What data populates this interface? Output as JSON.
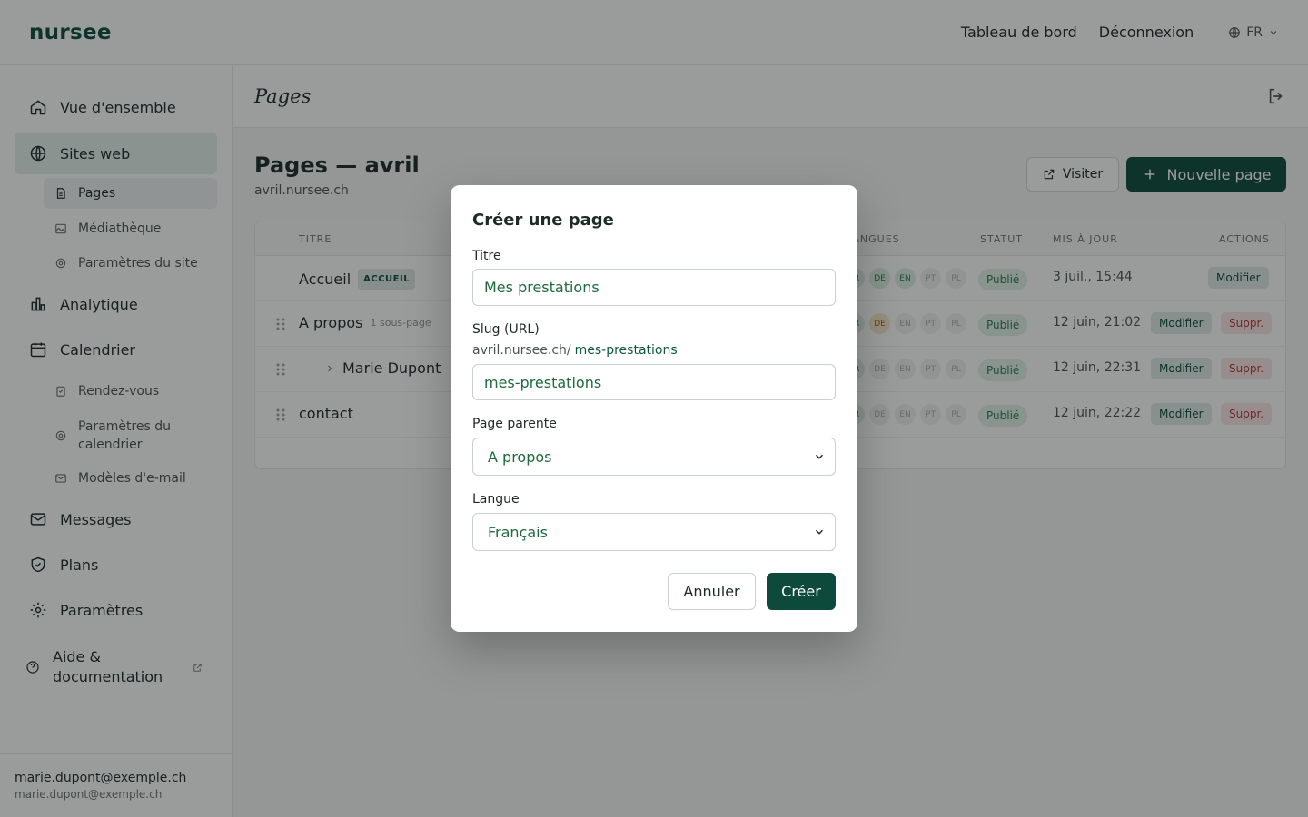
{
  "brand": "nursee",
  "topnav": {
    "dashboard": "Tableau de bord",
    "logout": "Déconnexion",
    "language": "FR"
  },
  "sidebar": {
    "items": [
      {
        "label": "Vue d'ensemble"
      },
      {
        "label": "Sites web"
      },
      {
        "label": "Analytique"
      },
      {
        "label": "Calendrier"
      },
      {
        "label": "Messages"
      },
      {
        "label": "Plans"
      },
      {
        "label": "Paramètres"
      },
      {
        "label": "Aide & documentation"
      }
    ],
    "site_sub": [
      "Pages",
      "Médiathèque",
      "Paramètres du site"
    ],
    "calendar_sub": [
      "Rendez-vous",
      "Paramètres du calendrier",
      "Modèles d'e-mail"
    ],
    "user_name": "marie.dupont@exemple.ch",
    "user_email": "marie.dupont@exemple.ch"
  },
  "main": {
    "header_title": "Pages",
    "page_title": "Pages — avril",
    "page_domain": "avril.nursee.ch",
    "visit_label": "Visiter",
    "new_page_label": "Nouvelle page"
  },
  "table": {
    "headers": {
      "title": "TITRE",
      "languages": "LANGUES",
      "status": "STATUT",
      "updated": "MIS À JOUR",
      "actions": "ACTIONS"
    },
    "rows": [
      {
        "title": "Accueil",
        "badge": "ACCUEIL",
        "status": "Publié",
        "updated": "3 juil., 15:44",
        "edit": "Modifier"
      },
      {
        "title": "A propos",
        "sub": "1 sous-page",
        "status": "Publié",
        "updated": "12 juin, 21:02",
        "edit": "Modifier",
        "delete": "Suppr."
      },
      {
        "title": "Marie Dupont",
        "status": "Publié",
        "updated": "12 juin, 22:31",
        "edit": "Modifier",
        "delete": "Suppr."
      },
      {
        "title": "contact",
        "status": "Publié",
        "updated": "12 juin, 22:22",
        "edit": "Modifier",
        "delete": "Suppr."
      }
    ],
    "lang_codes": [
      "FR",
      "DE",
      "EN",
      "PT",
      "PL"
    ]
  },
  "modal": {
    "title": "Créer une page",
    "title_label": "Titre",
    "title_value": "Mes prestations",
    "slug_label": "Slug (URL)",
    "slug_prefix": "avril.nursee.ch/",
    "slug_preview": "mes-prestations",
    "slug_value": "mes-prestations",
    "parent_label": "Page parente",
    "parent_value": "A propos",
    "lang_label": "Langue",
    "lang_value": "Français",
    "cancel": "Annuler",
    "create": "Créer"
  },
  "colors": {
    "brand": "#0d4a3c",
    "accent_text": "#1f6a3e",
    "published_bg": "#e1f1e6",
    "delete_text": "#b33a3a"
  }
}
